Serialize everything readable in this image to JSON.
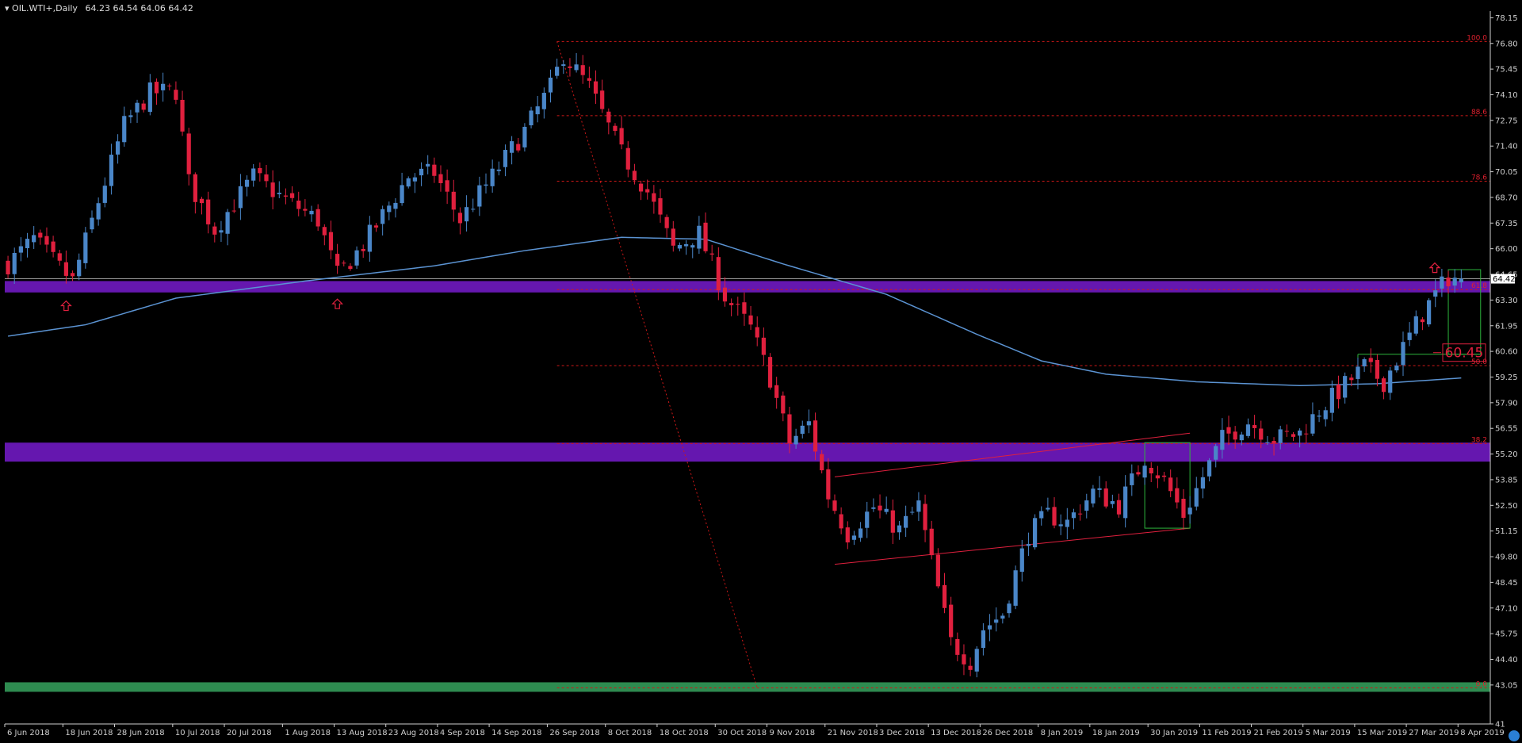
{
  "header": {
    "symbol": "OIL.WTI+,Daily",
    "ohlc": "64.23 64.54 64.06 64.42"
  },
  "colors": {
    "background": "#000000",
    "bull": "#4a86c8",
    "bear": "#e0203e",
    "ma": "#5b93d2",
    "zone": "#6a18b8",
    "bottom_zone": "#2e8b50",
    "fib": "#d01818",
    "box": "#2db43c",
    "axis": "#cfcfcf"
  },
  "chart_data": {
    "type": "candlestick",
    "title": "OIL.WTI+,Daily",
    "ylim": [
      41.0,
      78.5
    ],
    "y_ticks": [
      "78.15",
      "76.80",
      "75.45",
      "74.10",
      "72.75",
      "71.40",
      "70.05",
      "68.70",
      "67.35",
      "66.00",
      "64.65",
      "63.30",
      "61.95",
      "60.60",
      "59.25",
      "57.90",
      "56.55",
      "55.20",
      "53.85",
      "52.50",
      "51.15",
      "49.80",
      "48.45",
      "47.10",
      "45.75",
      "44.40",
      "43.05",
      "41"
    ],
    "x_ticks": [
      "6 Jun 2018",
      "18 Jun 2018",
      "28 Jun 2018",
      "10 Jul 2018",
      "20 Jul 2018",
      "1 Aug 2018",
      "13 Aug 2018",
      "23 Aug 2018",
      "4 Sep 2018",
      "14 Sep 2018",
      "26 Sep 2018",
      "8 Oct 2018",
      "18 Oct 2018",
      "30 Oct 2018",
      "9 Nov 2018",
      "21 Nov 2018",
      "3 Dec 2018",
      "13 Dec 2018",
      "26 Dec 2018",
      "8 Jan 2019",
      "18 Jan 2019",
      "30 Jan 2019",
      "11 Feb 2019",
      "21 Feb 2019",
      "5 Mar 2019",
      "15 Mar 2019",
      "27 Mar 2019",
      "8 Apr 2019"
    ],
    "x_ticks_index": [
      0,
      9,
      17,
      26,
      34,
      43,
      51,
      59,
      67,
      75,
      84,
      93,
      101,
      110,
      118,
      127,
      135,
      143,
      151,
      160,
      168,
      177,
      185,
      193,
      201,
      209,
      217,
      225
    ],
    "key_closes": [
      [
        0,
        65.2
      ],
      [
        4,
        66.5
      ],
      [
        8,
        65.0
      ],
      [
        10,
        64.3
      ],
      [
        14,
        68.5
      ],
      [
        18,
        72.5
      ],
      [
        22,
        74.2
      ],
      [
        26,
        74.3
      ],
      [
        28,
        69.5
      ],
      [
        32,
        67.0
      ],
      [
        38,
        69.8
      ],
      [
        42,
        68.8
      ],
      [
        48,
        67.5
      ],
      [
        51,
        64.6
      ],
      [
        55,
        66.2
      ],
      [
        62,
        69.8
      ],
      [
        66,
        70.0
      ],
      [
        70,
        67.5
      ],
      [
        75,
        69.8
      ],
      [
        80,
        72.2
      ],
      [
        84,
        74.5
      ],
      [
        86,
        76.2
      ],
      [
        90,
        74.5
      ],
      [
        95,
        71.0
      ],
      [
        99,
        69.0
      ],
      [
        103,
        66.0
      ],
      [
        107,
        66.8
      ],
      [
        111,
        63.5
      ],
      [
        115,
        61.8
      ],
      [
        118,
        59.2
      ],
      [
        121,
        55.8
      ],
      [
        124,
        56.8
      ],
      [
        127,
        53.0
      ],
      [
        130,
        51.0
      ],
      [
        134,
        52.4
      ],
      [
        138,
        51.2
      ],
      [
        141,
        52.5
      ],
      [
        143,
        49.5
      ],
      [
        146,
        45.3
      ],
      [
        149,
        44.3
      ],
      [
        151,
        46.0
      ],
      [
        154,
        46.8
      ],
      [
        158,
        51.0
      ],
      [
        161,
        52.0
      ],
      [
        164,
        51.6
      ],
      [
        168,
        53.2
      ],
      [
        172,
        52.5
      ],
      [
        176,
        55.0
      ],
      [
        179,
        53.8
      ],
      [
        182,
        52.0
      ],
      [
        185,
        54.0
      ],
      [
        188,
        56.0
      ],
      [
        192,
        56.9
      ],
      [
        196,
        56.0
      ],
      [
        200,
        56.3
      ],
      [
        203,
        57.5
      ],
      [
        206,
        58.5
      ],
      [
        210,
        59.8
      ],
      [
        213,
        59.0
      ],
      [
        215,
        60.2
      ],
      [
        217,
        61.4
      ],
      [
        219,
        62.6
      ],
      [
        221,
        63.6
      ],
      [
        223,
        64.5
      ],
      [
        225,
        64.42
      ]
    ],
    "moving_average": [
      [
        0,
        61.4
      ],
      [
        12,
        62.0
      ],
      [
        26,
        63.4
      ],
      [
        46,
        64.3
      ],
      [
        66,
        65.1
      ],
      [
        80,
        65.9
      ],
      [
        95,
        66.6
      ],
      [
        108,
        66.5
      ],
      [
        120,
        65.2
      ],
      [
        136,
        63.6
      ],
      [
        150,
        61.5
      ],
      [
        160,
        60.1
      ],
      [
        170,
        59.4
      ],
      [
        184,
        59.0
      ],
      [
        200,
        58.8
      ],
      [
        212,
        58.9
      ],
      [
        225,
        59.2
      ]
    ],
    "current_price": "64.42",
    "level_label": "60.45",
    "fib_levels": [
      {
        "label": "100.0",
        "value": 76.9
      },
      {
        "label": "88.6",
        "value": 73.0
      },
      {
        "label": "78.6",
        "value": 69.55
      },
      {
        "label": "61.8",
        "value": 63.85
      },
      {
        "label": "50.0",
        "value": 59.85
      },
      {
        "label": "38.2",
        "value": 55.75
      },
      {
        "label": "0.0",
        "value": 42.9
      }
    ],
    "zones": [
      {
        "from": 63.7,
        "to": 64.3
      },
      {
        "from": 54.8,
        "to": 55.8
      }
    ]
  }
}
